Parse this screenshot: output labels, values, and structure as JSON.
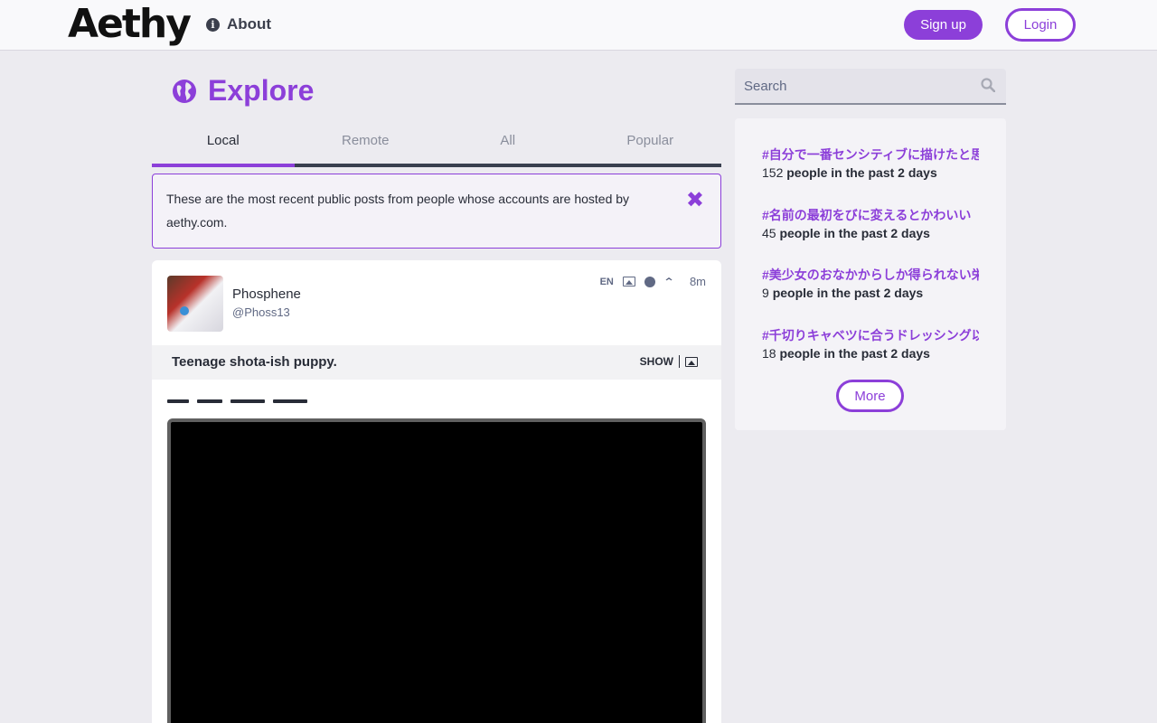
{
  "header": {
    "logo": "Aethy",
    "about_label": "About",
    "signup_label": "Sign up",
    "login_label": "Login"
  },
  "explore": {
    "title": "Explore",
    "tabs": [
      {
        "label": "Local",
        "active": true
      },
      {
        "label": "Remote",
        "active": false
      },
      {
        "label": "All",
        "active": false
      },
      {
        "label": "Popular",
        "active": false
      }
    ],
    "notice": "These are the most recent public posts from people whose accounts are hosted by aethy.com."
  },
  "post": {
    "author_name": "Phosphene",
    "author_handle": "@Phoss13",
    "language": "EN",
    "time": "8m",
    "content_warning": "Teenage shota-ish puppy.",
    "show_label": "SHOW"
  },
  "search": {
    "placeholder": "Search"
  },
  "trends": [
    {
      "tag": "#自分で一番センシティブに描けたと思う",
      "count": "152",
      "suffix": "people in the past 2 days"
    },
    {
      "tag": "#名前の最初をびに変えるとかわいい",
      "count": "45",
      "suffix": "people in the past 2 days"
    },
    {
      "tag": "#美少女のおなかからしか得られない栄養",
      "count": "9",
      "suffix": "people in the past 2 days"
    },
    {
      "tag": "#千切りキャベツに合うドレッシング以外",
      "count": "18",
      "suffix": "people in the past 2 days"
    }
  ],
  "more_label": "More",
  "colors": {
    "accent": "#8c3fd9",
    "background": "#ecebf0",
    "text": "#282c37"
  }
}
